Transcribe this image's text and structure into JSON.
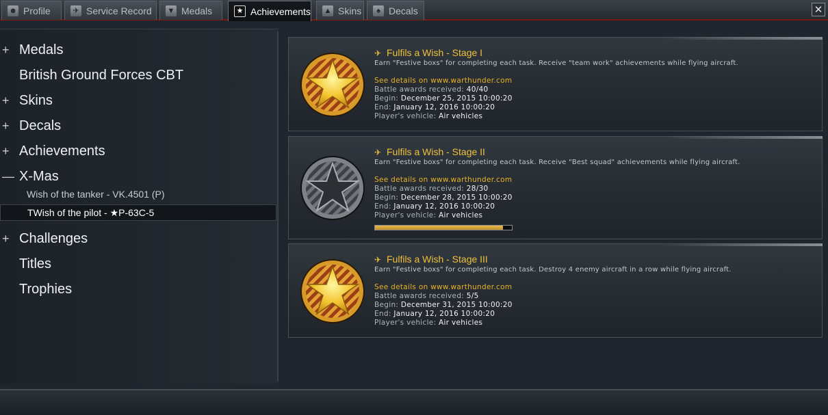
{
  "tabs": [
    {
      "label": "Profile",
      "icon": "profile-icon",
      "active": false
    },
    {
      "label": "Service Record",
      "icon": "service-record-icon",
      "active": false
    },
    {
      "label": "Medals",
      "icon": "medal-icon",
      "active": false
    },
    {
      "label": "Achievements",
      "icon": "star-icon",
      "active": true
    },
    {
      "label": "Skins",
      "icon": "tank-icon",
      "active": false
    },
    {
      "label": "Decals",
      "icon": "spade-icon",
      "active": false
    }
  ],
  "close_label": "✕",
  "nav": {
    "items": [
      {
        "prefix": "+",
        "label": "Medals"
      },
      {
        "prefix": "",
        "label": "British Ground Forces CBT"
      },
      {
        "prefix": "+",
        "label": "Skins"
      },
      {
        "prefix": "+",
        "label": "Decals"
      },
      {
        "prefix": "+",
        "label": "Achievements"
      },
      {
        "prefix": "—",
        "label": "X-Mas"
      },
      {
        "prefix": "+",
        "label": "Challenges"
      },
      {
        "prefix": "",
        "label": "Titles"
      },
      {
        "prefix": "",
        "label": "Trophies"
      }
    ],
    "sub_items": [
      {
        "label": "Wish of the tanker - VK.4501 (P)",
        "selected": false
      },
      {
        "label": "TWish of the pilot - ★P-63C-5",
        "selected": true
      }
    ]
  },
  "labels": {
    "link": "See details on www.warthunder.com",
    "battle": "Battle awards received: ",
    "begin": "Begin: ",
    "end": "End: ",
    "vehicle": "Player's vehicle: "
  },
  "achievements": [
    {
      "title": "Fulfils a Wish - Stage I",
      "desc": "Earn \"Festive boxs\" for completing each task. Receive \"team work\" achievements while flying aircraft.",
      "awards": "40/40",
      "begin": "December 25, 2015 10:00:20",
      "end": "January 12, 2016 10:00:20",
      "vehicle": "Air vehicles",
      "medal": "gold",
      "progress": null
    },
    {
      "title": "Fulfils a Wish - Stage II",
      "desc": "Earn \"Festive boxs\" for completing each task. Receive \"Best squad\" achievements while flying aircraft.",
      "awards": "28/30",
      "begin": "December 28, 2015 10:00:20",
      "end": "January 12, 2016 10:00:20",
      "vehicle": "Air vehicles",
      "medal": "gray",
      "progress": 0.933
    },
    {
      "title": "Fulfils a Wish - Stage III",
      "desc": "Earn \"Festive boxs\" for completing each task. Destroy 4 enemy aircraft in a row while flying aircraft.",
      "awards": "5/5",
      "begin": "December 31, 2015 10:00:20",
      "end": "January 12, 2016 10:00:20",
      "vehicle": "Air vehicles",
      "medal": "gold",
      "progress": null
    }
  ],
  "colors": {
    "accent": "#f0c13c",
    "link": "#e8b228",
    "tab_underline": "#7a1a12"
  }
}
